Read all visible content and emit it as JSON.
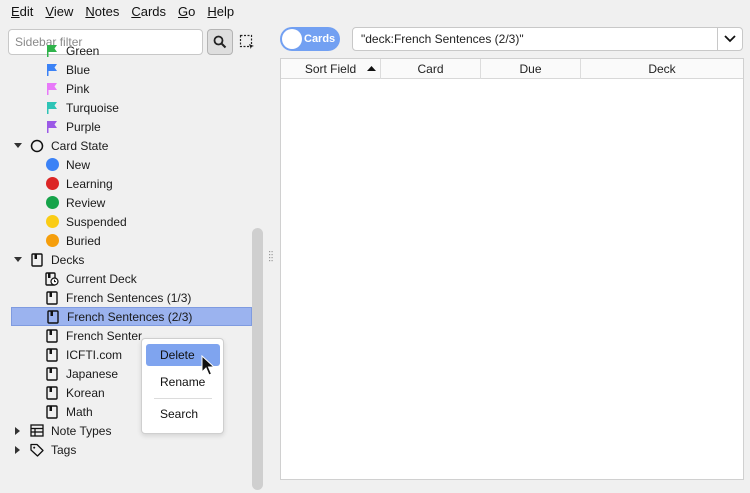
{
  "menubar": {
    "items": [
      {
        "mnemonic": "E",
        "rest": "dit"
      },
      {
        "mnemonic": "V",
        "rest": "iew"
      },
      {
        "mnemonic": "N",
        "rest": "otes"
      },
      {
        "mnemonic": "C",
        "rest": "ards"
      },
      {
        "mnemonic": "G",
        "rest": "o"
      },
      {
        "mnemonic": "H",
        "rest": "elp"
      }
    ]
  },
  "sidebar": {
    "filter_placeholder": "Sidebar filter",
    "flags": [
      {
        "label": "Green",
        "color": "#2fb34b"
      },
      {
        "label": "Blue",
        "color": "#3b82f6"
      },
      {
        "label": "Pink",
        "color": "#e879f9"
      },
      {
        "label": "Turquoise",
        "color": "#2ec4b6"
      },
      {
        "label": "Purple",
        "color": "#9b59e6"
      }
    ],
    "card_state": {
      "label": "Card State",
      "items": [
        {
          "label": "New",
          "color": "#3b82f6"
        },
        {
          "label": "Learning",
          "color": "#dc2626"
        },
        {
          "label": "Review",
          "color": "#16a34a"
        },
        {
          "label": "Suspended",
          "color": "#facc15"
        },
        {
          "label": "Buried",
          "color": "#f59e0b"
        }
      ]
    },
    "decks": {
      "label": "Decks",
      "items": [
        {
          "label": "Current Deck"
        },
        {
          "label": "French Sentences (1/3)"
        },
        {
          "label": "French Sentences (2/3)"
        },
        {
          "label": "French Senter"
        },
        {
          "label": "ICFTI.com"
        },
        {
          "label": "Japanese"
        },
        {
          "label": "Korean"
        },
        {
          "label": "Math"
        }
      ]
    },
    "note_types": "Note Types",
    "tags": "Tags"
  },
  "toggle": {
    "label": "Cards"
  },
  "search": {
    "query": "\"deck:French Sentences (2/3)\""
  },
  "table": {
    "columns": [
      "Sort Field",
      "Card",
      "Due",
      "Deck"
    ]
  },
  "context_menu": {
    "items": [
      "Delete",
      "Rename",
      "Search"
    ]
  }
}
